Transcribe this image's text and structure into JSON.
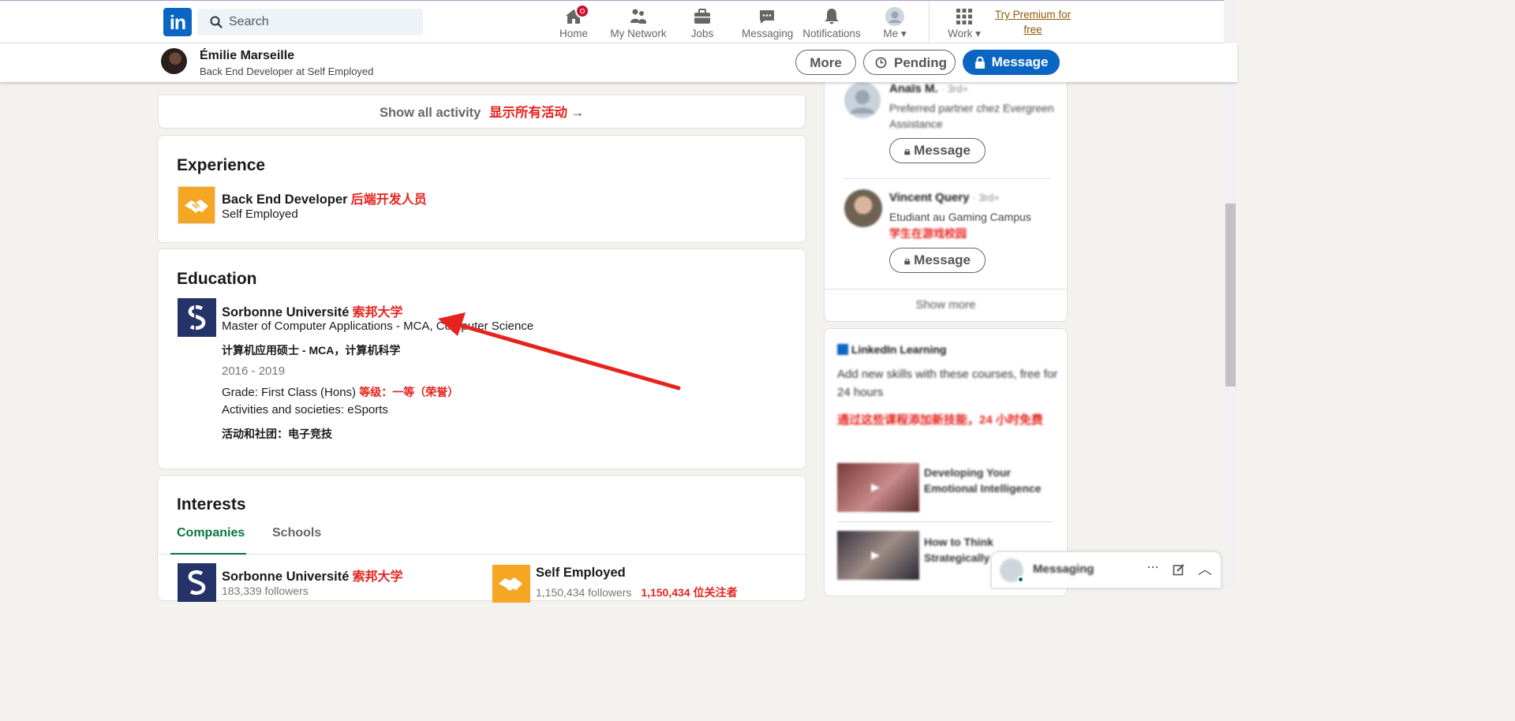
{
  "nav": {
    "logo_text": "in",
    "search_placeholder": "Search",
    "items": [
      {
        "label": "Home",
        "icon": "home-icon"
      },
      {
        "label": "My Network",
        "icon": "my-network-icon"
      },
      {
        "label": "Jobs",
        "icon": "jobs-icon"
      },
      {
        "label": "Messaging",
        "icon": "messaging-icon"
      },
      {
        "label": "Notifications",
        "icon": "notifications-icon"
      },
      {
        "label": "Me",
        "icon": "avatar-icon"
      },
      {
        "label": "Work",
        "icon": "grid-icon"
      }
    ],
    "premium_line1": "Try Premium for",
    "premium_line2": "free",
    "home_badge": "notification-badge"
  },
  "sticky": {
    "name": "Émilie Marseille",
    "title": "Back End Developer at Self Employed",
    "more": "More",
    "pending": "Pending",
    "message": "Message"
  },
  "activity": {
    "show_all": "Show all activity",
    "show_all_cn": "显示所有活动",
    "arrow": "→"
  },
  "experience": {
    "heading": "Experience",
    "role": "Back End Developer",
    "role_cn": "后端开发人员",
    "company": "Self Employed"
  },
  "education": {
    "heading": "Education",
    "school": "Sorbonne Université",
    "school_cn": "索邦大学",
    "degree": "Master of Computer Applications - MCA, Computer Science",
    "degree_cn": "计算机应用硕士 - MCA，计算机科学",
    "dates": "2016 - 2019",
    "grade": "Grade: First Class (Hons)",
    "grade_cn": "等级：一等（荣誉）",
    "activities": "Activities and societies: eSports",
    "activities_cn": "活动和社团：电子竞技"
  },
  "interests": {
    "heading": "Interests",
    "tabs": [
      "Companies",
      "Schools"
    ],
    "items": [
      {
        "name": "Sorbonne Université",
        "name_cn": "索邦大学",
        "followers": "183,339 followers"
      },
      {
        "name": "Self Employed",
        "name_cn": "",
        "followers": "1,150,434 followers",
        "followers_cn": "1,150,434 位关注者"
      }
    ]
  },
  "right_panel": {
    "people": [
      {
        "name": "Anaïs M.",
        "degree": "· 3rd+",
        "headline": "Preferred partner chez Evergreen Assistance",
        "button": "Message"
      },
      {
        "name": "Vincent Query",
        "degree": "· 3rd+",
        "headline": "Etudiant au Gaming Campus",
        "headline_cn": "学生在游戏校园",
        "button": "Message"
      }
    ],
    "show_more": "Show more",
    "learning": {
      "title": "LinkedIn Learning",
      "text": "Add new skills with these courses, free for 24 hours",
      "text_cn": "通过这些课程添加新技能，24 小时免费",
      "courses": [
        {
          "title": "Developing Your Emotional Intelligence"
        },
        {
          "title": "How to Think Strategically"
        }
      ]
    }
  },
  "messaging": {
    "label": "Messaging"
  },
  "colors": {
    "brand": "#0a66c2",
    "annotation_red": "#e6231e",
    "active_tab": "#057642",
    "premium": "#915907"
  }
}
